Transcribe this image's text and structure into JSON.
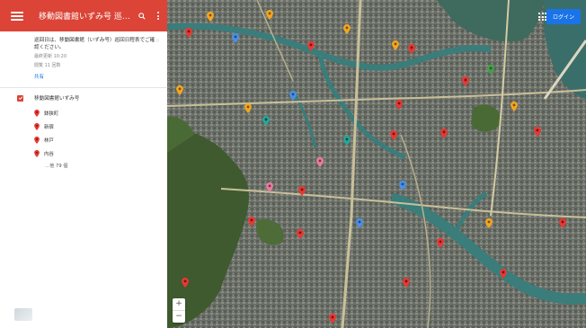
{
  "appbar": {
    "title": "移動図書館いずみ号 巡…"
  },
  "description": {
    "text": "巡回日は、移動図書館（いずみ号）巡回日程表でご確認ください。",
    "meta_line1": "最終更新 10:20",
    "meta_line2": "閲覧 11 回数",
    "share_label": "共有"
  },
  "layer": {
    "name": "移動図書館いずみ号",
    "items": [
      {
        "label": "鉢狭町"
      },
      {
        "label": "新宿"
      },
      {
        "label": "林戸"
      },
      {
        "label": "内谷"
      }
    ],
    "more_label": "…他 79 個"
  },
  "map": {
    "signin_label": "ログイン",
    "zoom_in": "+",
    "zoom_out": "−"
  },
  "colors": {
    "appbar": "#db4437",
    "marker_red": "#e53935",
    "marker_orange": "#f4a620",
    "marker_blue": "#4a8fe7",
    "marker_teal": "#26a69a",
    "marker_pink": "#e57fa0",
    "marker_green": "#43a047",
    "signin": "#1a73e8"
  }
}
